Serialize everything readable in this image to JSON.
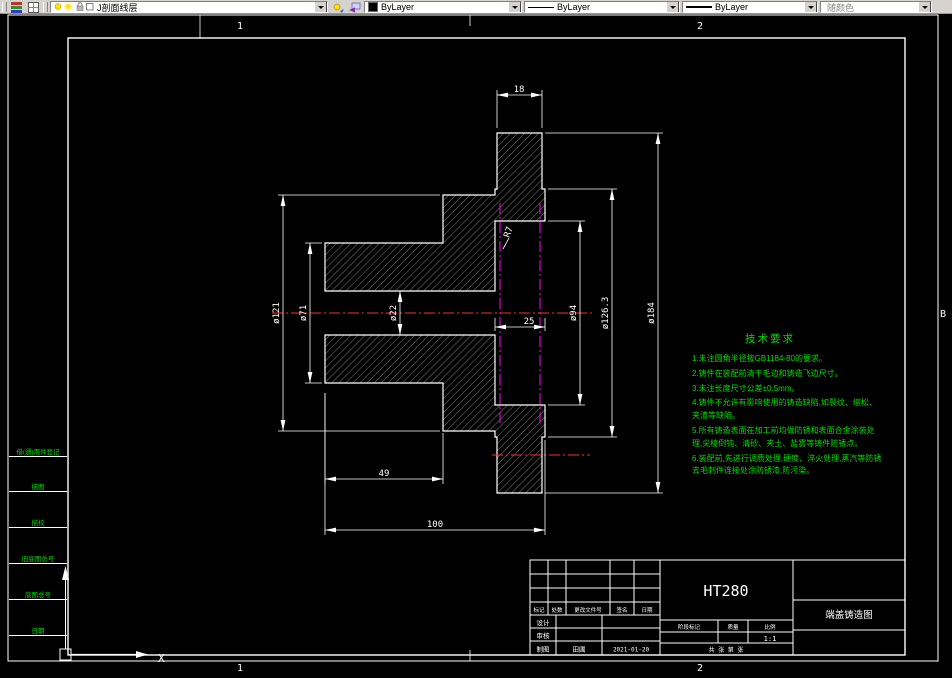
{
  "toolbar": {
    "layer_name": "J剖面线层",
    "color": "ByLayer",
    "linetype": "ByLayer",
    "lineweight": "ByLayer",
    "plot_style": "随颜色"
  },
  "frame": {
    "zone_top_1": "1",
    "zone_top_2": "2",
    "zone_bottom_1": "1",
    "zone_bottom_2": "2",
    "zone_right": "B"
  },
  "margin_fields": [
    "借(通)用件登记",
    "描图",
    "描校",
    "旧底图总号",
    "底图总号",
    "日期"
  ],
  "ucs": {
    "x_label": "X"
  },
  "dimensions": {
    "rim_width": "18",
    "rim_bore_width": "25",
    "hub_length": "49",
    "total_length": "100",
    "bore_dia": "ø22",
    "hub_dia": "ø71",
    "flange_dia": "ø121",
    "rim_inner_dia": "ø94",
    "rim_step_dia": "ø126.3",
    "outer_dia": "ø184",
    "fillet": "R7"
  },
  "tech_requirements": {
    "title": "技术要求",
    "items": [
      "1.未注圆角半径按GB1184-80的要求。",
      "2.铸件在装配前清干毛边和铸造飞边尺寸。",
      "3.未注长度尺寸公差±0.5mm。",
      "4.铸件不允许有影响使用的铸造缺陷,如裂纹、缩松、夹渣等缺陷。",
      "5.所有铸造表面在加工前均做防锈和表面合金涂装处理,尖棱倒钝、清砂、夹土、盐雾等铸件防锈点。",
      "6.装配前,先进行调质处理,硬度、淬火处理,蒸汽等防锈去毛刺件连接处涂防锈漆,防污染。"
    ]
  },
  "title_block": {
    "material": "HT280",
    "drawing_name": "端盖铸造图",
    "scale": "1:1",
    "date": "2021-01-20",
    "drafter": "田圃",
    "labels": {
      "mark": "标记",
      "count": "处数",
      "change_doc": "更改文件号",
      "sign": "签名",
      "date": "日期",
      "design": "设计",
      "review": "审核",
      "draft": "制图",
      "stage": "阶段标记",
      "weight": "质量",
      "scale": "比例",
      "sheets": "共 张 第 张"
    }
  }
}
